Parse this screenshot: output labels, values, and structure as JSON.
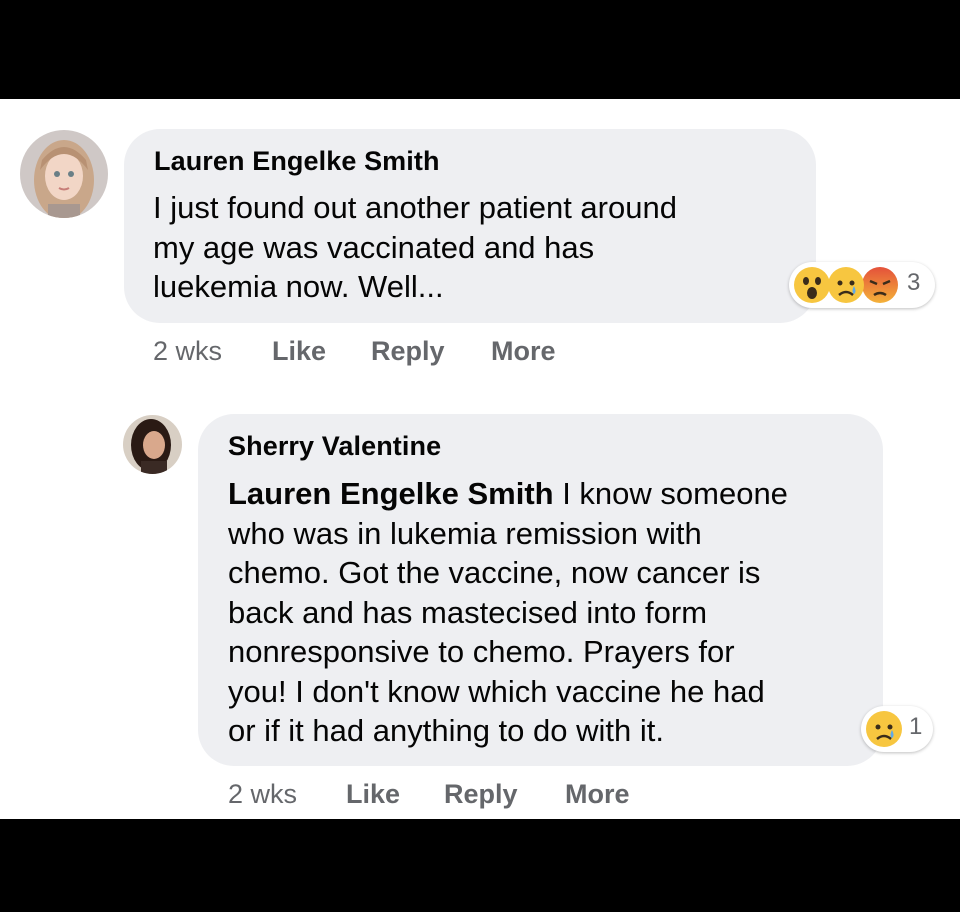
{
  "comments": [
    {
      "author": "Lauren Engelke Smith",
      "text": "I just found out another patient around\nmy age was vaccinated and has\nluekemia now. Well...",
      "time": "2 wks",
      "like": "Like",
      "reply": "Reply",
      "more": "More",
      "reactions": {
        "icons": [
          "wow-icon",
          "sad-icon",
          "angry-icon"
        ],
        "count": "3"
      }
    },
    {
      "author": "Sherry Valentine",
      "mention": "Lauren Engelke Smith",
      "text": " I know someone\nwho was in lukemia remission with\nchemo. Got the vaccine, now cancer is\nback and has mastecised into form\nnonresponsive to chemo. Prayers for\nyou! I don't know which vaccine he had\nor if it had anything to do with it.",
      "time": "2 wks",
      "like": "Like",
      "reply": "Reply",
      "more": "More",
      "reactions": {
        "icons": [
          "sad-icon"
        ],
        "count": "1"
      }
    }
  ],
  "colors": {
    "bubble": "#eeeff2",
    "meta_text": "#65676b",
    "body_text": "#050505",
    "frame": "#000000"
  }
}
